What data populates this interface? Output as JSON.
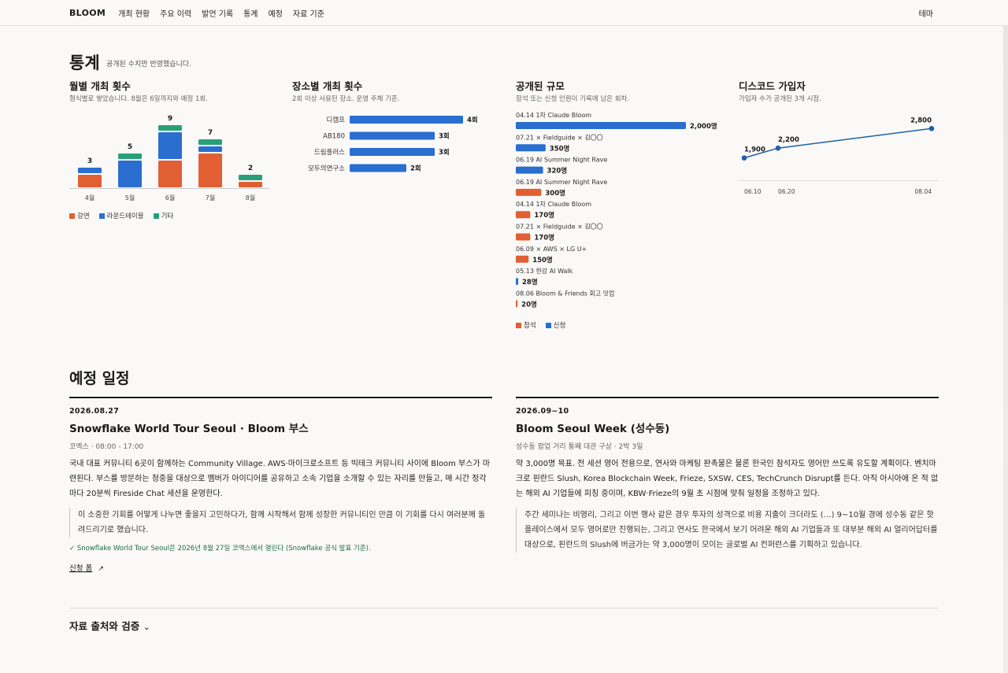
{
  "nav": {
    "logo": "BLOOM",
    "items": [
      "개최 현황",
      "주요 이력",
      "발언 기록",
      "통계",
      "예정",
      "자료 기준"
    ],
    "theme": "테마"
  },
  "stats": {
    "title": "통계",
    "subtitle": "공개된 수치만 반영했습니다.",
    "monthly": {
      "title": "월별 개최 횟수",
      "subtitle": "형식별로 쌓았습니다. 8월은 6일까지와 예정 1회."
    },
    "venue": {
      "title": "장소별 개최 횟수",
      "subtitle": "2회 이상 사용된 장소. 운영 주체 기준."
    },
    "scale": {
      "title": "공개된 규모",
      "subtitle": "참석 또는 신청 인원이 기록에 남은 회차."
    },
    "discord": {
      "title": "디스코드 가입자",
      "subtitle": "가입자 수가 공개된 3개 시점."
    }
  },
  "colors": {
    "talk": "#e15f33",
    "roundtable": "#2a6ed0",
    "other": "#27a07a",
    "attend": "#e15f33",
    "apply": "#2a6ed0",
    "line": "#1f5fa8"
  },
  "chart_data": [
    {
      "type": "bar",
      "title": "월별 개최 횟수",
      "categories": [
        "4월",
        "5월",
        "6월",
        "7월",
        "8월"
      ],
      "series": [
        {
          "name": "강연",
          "values": [
            2,
            0,
            4,
            5,
            1
          ]
        },
        {
          "name": "라운드테이블",
          "values": [
            1,
            4,
            4,
            1,
            0
          ]
        },
        {
          "name": "기타",
          "values": [
            0,
            1,
            1,
            1,
            1
          ]
        }
      ],
      "totals": [
        3,
        5,
        9,
        7,
        2
      ],
      "legend": "bottom-left"
    },
    {
      "type": "bar",
      "title": "장소별 개최 횟수",
      "categories": [
        "디캠프",
        "AB180",
        "드림플러스",
        "모두의연구소"
      ],
      "values": [
        4,
        3,
        3,
        2
      ],
      "value_labels": [
        "4회",
        "3회",
        "3회",
        "2회"
      ]
    },
    {
      "type": "bar",
      "title": "공개된 규모",
      "categories": [
        "04.14 1차 Claude Bloom",
        "07.21 × Fieldguide × 김〇〇",
        "06.19 AI Summer Night Rave",
        "06.19 AI Summer Night Rave",
        "04.14 1차 Claude Bloom",
        "07.21 × Fieldguide × 김〇〇",
        "06.09 × AWS × LG U+",
        "05.13 한강 AI Walk",
        "08.06 Bloom & Friends 회고 밋업"
      ],
      "values": [
        2000,
        350,
        320,
        300,
        170,
        170,
        150,
        28,
        20
      ],
      "kinds": [
        "신청",
        "신청",
        "신청",
        "참석",
        "참석",
        "참석",
        "참석",
        "신청",
        "참석"
      ],
      "value_labels": [
        "2,000명",
        "350명",
        "320명",
        "300명",
        "170명",
        "170명",
        "150명",
        "28명",
        "20명"
      ],
      "legend_labels": [
        "참석",
        "신청"
      ]
    },
    {
      "type": "line",
      "title": "디스코드 가입자",
      "x": [
        "06.10",
        "06.20",
        "08.04"
      ],
      "y": [
        1900,
        2200,
        2800
      ],
      "value_labels": [
        "1,900",
        "2,200",
        "2,800"
      ]
    }
  ],
  "schedule": {
    "title": "예정 일정",
    "events": [
      {
        "date": "2026.08.27",
        "title": "Snowflake World Tour Seoul · Bloom 부스",
        "meta": "코엑스 · 08:00 - 17:00",
        "body": "국내 대표 커뮤니티 6곳이 함께하는 Community Village. AWS·마이크로소프트 등 빅테크 커뮤니티 사이에 Bloom 부스가 마련된다. 부스를 방문하는 청중을 대상으로 멤버가 아이디어를 공유하고 소속 기업을 소개할 수 있는 자리를 만들고, 매 시간 정각마다 20분씩 Fireside Chat 세션을 운영한다.",
        "quote": "이 소중한 기회를 어떻게 나누면 좋을지 고민하다가, 함께 시작해서 함께 성장한 커뮤니티인 만큼 이 기회를 다시 여러분께 돌려드리기로 했습니다.",
        "check": "Snowflake World Tour Seoul은 2026년 8월 27일 코엑스에서 열린다 (Snowflake 공식 발표 기준).",
        "link": "신청 폼"
      },
      {
        "date": "2026.09~10",
        "title": "Bloom Seoul Week (성수동)",
        "meta": "성수동 팝업 거리 통째 대관 구상 · 2박 3일",
        "body": "약 3,000명 목표. 전 세션 영어 전용으로, 연사와 마케팅 판촉물은 물론 한국인 참석자도 영어만 쓰도록 유도할 계획이다. 벤치마크로 핀란드 Slush, Korea Blockchain Week, Frieze, SXSW, CES, TechCrunch Disrupt를 든다. 아직 아시아에 온 적 없는 해외 AI 기업들에 피칭 중이며, KBW·Frieze의 9월 초 시점에 맞춰 일정을 조정하고 있다.",
        "quote": "주간 세미나는 비영리, 그리고 이번 행사 같은 경우 투자의 성격으로 비용 지출이 크더라도 (…) 9~10월 경에 성수동 같은 핫플레이스에서 모두 영어로만 진행되는, 그리고 연사도 한국에서 보기 어려운 해외 AI 기업들과 또 대부분 해외 AI 얼리어답터를 대상으로, 핀란드의 Slush에 버금가는 약 3,000명이 모이는 글로벌 AI 컨퍼런스를 기획하고 있습니다."
      }
    ]
  },
  "footer": {
    "sources_title": "자료 출처와 검증"
  }
}
